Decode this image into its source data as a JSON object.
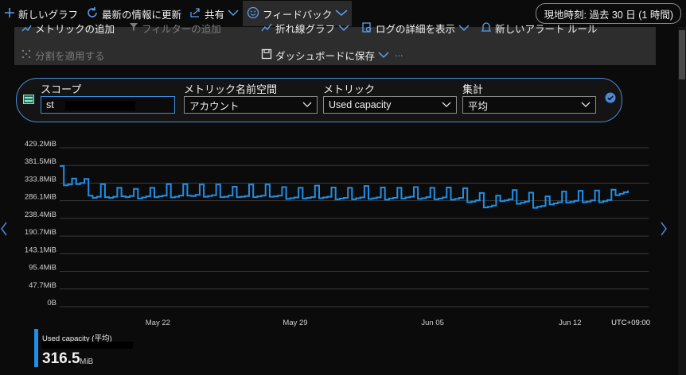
{
  "toolbar": {
    "new_chart": "新しいグラフ",
    "refresh": "最新の情報に更新",
    "share": "共有",
    "feedback": "フィードバック",
    "time_range": "現地時刻: 過去 30 日 (1 時間)"
  },
  "panel": {
    "add_metric": "メトリックの追加",
    "add_filter": "フィルターの追加",
    "line_chart": "折れ線グラフ",
    "view_logs": "ログの詳細を表示",
    "new_alert": "新しいアラート ルール",
    "apply_split": "分割を適用する",
    "save_dashboard": "ダッシュボードに保存",
    "more": "..."
  },
  "scope_bar": {
    "scope_label": "スコープ",
    "scope_value": "st",
    "namespace_label": "メトリック名前空間",
    "namespace_value": "アカウント",
    "metric_label": "メトリック",
    "metric_value": "Used capacity",
    "aggregation_label": "集計",
    "aggregation_value": "平均"
  },
  "colors": {
    "series": "#1f8fe8",
    "accent": "#4a8ad8"
  },
  "chart_data": {
    "type": "line",
    "y_unit": "MiB",
    "y_ticks": [
      "429.2MiB",
      "381.5MiB",
      "333.8MiB",
      "286.1MiB",
      "238.4MiB",
      "190.7MiB",
      "143.1MiB",
      "95.4MiB",
      "47.7MiB",
      "0B"
    ],
    "ylim": [
      0,
      429.2
    ],
    "x_ticks": [
      "May 22",
      "May 29",
      "Jun 05",
      "Jun 12"
    ],
    "x_tick_days": [
      5,
      12,
      19,
      26
    ],
    "x_days": [
      30
    ],
    "timezone": "UTC+09:00",
    "grid": true,
    "series": [
      {
        "name": "Used capacity (平均)",
        "values": [
          380,
          328,
          330,
          346,
          331,
          334,
          345,
          300,
          294,
          297,
          331,
          296,
          294,
          297,
          321,
          298,
          296,
          299,
          318,
          292,
          295,
          298,
          321,
          296,
          298,
          300,
          331,
          295,
          297,
          300,
          331,
          300,
          299,
          302,
          330,
          297,
          299,
          301,
          330,
          296,
          297,
          300,
          324,
          296,
          297,
          299,
          330,
          296,
          298,
          300,
          330,
          297,
          298,
          300,
          323,
          291,
          293,
          295,
          321,
          292,
          294,
          296,
          327,
          293,
          295,
          297,
          322,
          290,
          292,
          294,
          321,
          290,
          293,
          295,
          326,
          291,
          293,
          295,
          322,
          289,
          292,
          294,
          321,
          292,
          295,
          297,
          323,
          291,
          293,
          296,
          321,
          290,
          292,
          295,
          322,
          289,
          291,
          294,
          320,
          282,
          284,
          287,
          307,
          268,
          270,
          273,
          300,
          285,
          287,
          290,
          315,
          278,
          281,
          284,
          308,
          267,
          270,
          272,
          298,
          276,
          279,
          282,
          311,
          281,
          283,
          286,
          313,
          282,
          284,
          287,
          314,
          282,
          285,
          288,
          316,
          301,
          305,
          309,
          314
        ]
      }
    ]
  },
  "legend": {
    "metric_label": "Used capacity (平均)",
    "value": "316.5",
    "unit": "MiB"
  }
}
